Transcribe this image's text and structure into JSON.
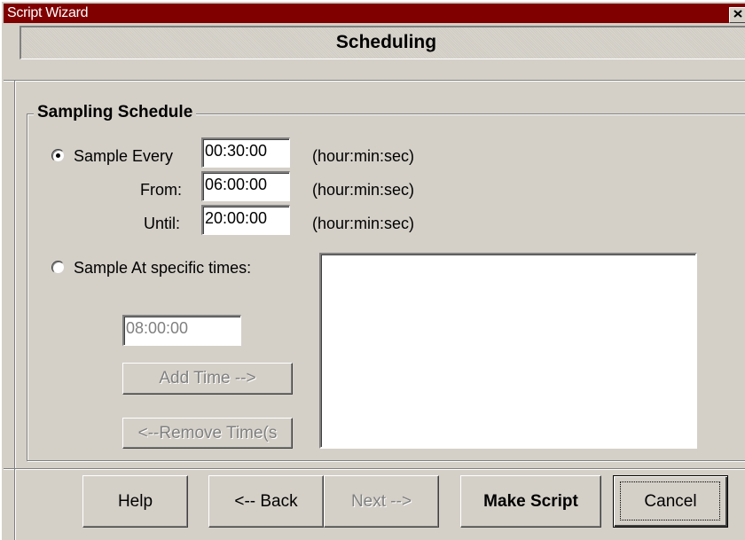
{
  "window": {
    "title": "Script Wizard",
    "close_icon": "close-icon"
  },
  "header": {
    "title": "Scheduling"
  },
  "group": {
    "label": "Sampling Schedule"
  },
  "sample_every": {
    "radio_label": "Sample Every",
    "selected": true,
    "interval_value": "00:30:00",
    "from_label": "From:",
    "from_value": "06:00:00",
    "until_label": "Until:",
    "until_value": "20:00:00",
    "format_hint": "(hour:min:sec)"
  },
  "sample_at": {
    "radio_label": "Sample At specific times:",
    "selected": false,
    "time_value": "08:00:00",
    "add_label": "Add Time -->",
    "remove_label": "<--Remove Time(s",
    "times": []
  },
  "footer": {
    "help_label": "Help",
    "back_label": "<-- Back",
    "next_label": "Next -->",
    "make_script_label": "Make Script",
    "cancel_label": "Cancel"
  },
  "colors": {
    "titlebar": "#800000",
    "face": "#d4d0c8"
  }
}
